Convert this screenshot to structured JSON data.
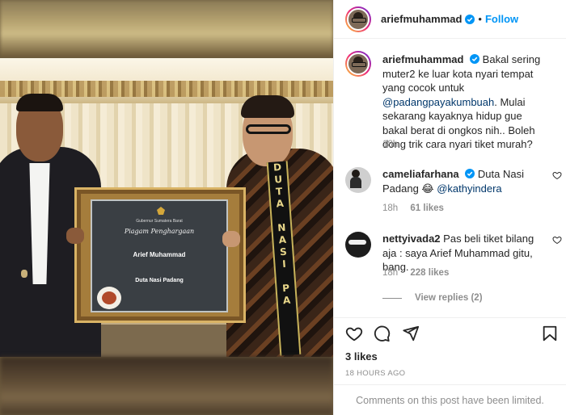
{
  "post": {
    "username": "ariefmuhammad",
    "follow_label": "Follow",
    "separator": "•",
    "caption_text": "Bakal sering muter2 ke luar kota nyari tempat yang cocok untuk ",
    "caption_mention": "@padangpayakumbuah",
    "caption_rest": ". Mulai sekarang kayaknya hidup gue bakal berat di ongkos nih.. Boleh dong trik cara nyari tiket murah?",
    "caption_time": "18h",
    "likes": "3 likes",
    "time_ago": "18 HOURS AGO",
    "comments_disabled": "Comments on this post have been limited."
  },
  "certificate": {
    "governor": "Gubernur Sumatera Barat",
    "title": "Piagam Penghargaan",
    "name": "Arief Muhammad",
    "role": "Duta Nasi Padang"
  },
  "sash_text": [
    "D",
    "U",
    "T",
    "A",
    "",
    "N",
    "A",
    "S",
    "I",
    "",
    "P",
    "A"
  ],
  "comments": [
    {
      "username": "cameliafarhana",
      "text": "Duta Nasi Padang 😂 ",
      "mention": "@kathyindera",
      "time": "18h",
      "likes": "61 likes"
    },
    {
      "username": "nettyivada2",
      "text": "Pas beli tiket bilang aja : saya Arief Muhammad gitu, bang.",
      "time": "18h",
      "likes": "228 likes"
    }
  ],
  "view_replies": "View replies (2)",
  "icons": {
    "verified": "verified-badge-icon",
    "heart": "heart-icon",
    "comment": "comment-icon",
    "share": "share-icon",
    "bookmark": "bookmark-icon"
  },
  "colors": {
    "accent": "#0095f6",
    "text": "#262626",
    "muted": "#8e8e8e",
    "link": "#00376b"
  }
}
